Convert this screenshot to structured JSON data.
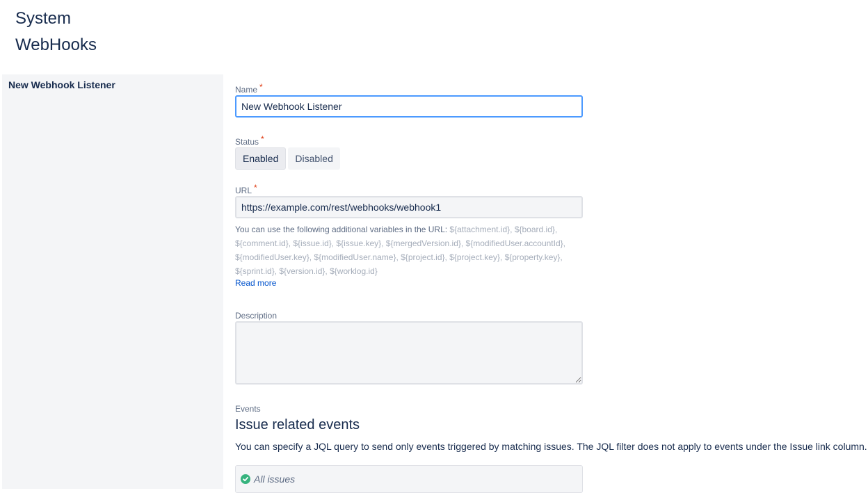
{
  "header": {
    "title_line1": "System",
    "title_line2": "WebHooks"
  },
  "sidebar": {
    "items": [
      {
        "label": "New Webhook Listener"
      }
    ]
  },
  "form": {
    "name": {
      "label": "Name",
      "required_mark": "*",
      "value": "New Webhook Listener"
    },
    "status": {
      "label": "Status",
      "required_mark": "*",
      "options": [
        "Enabled",
        "Disabled"
      ],
      "selected": "Enabled"
    },
    "url": {
      "label": "URL",
      "required_mark": "*",
      "value": "https://example.com/rest/webhooks/webhook1",
      "help_prefix": "You can use the following additional variables in the URL: ",
      "variables_line1": "${attachment.id}, ${board.id},",
      "variables_line2": "${comment.id}, ${issue.id}, ${issue.key}, ${mergedVersion.id}, ${modifiedUser.accountId},",
      "variables_line3": "${modifiedUser.key}, ${modifiedUser.name}, ${project.id}, ${project.key}, ${property.key},",
      "variables_line4": "${sprint.id}, ${version.id}, ${worklog.id}",
      "read_more": "Read more"
    },
    "description": {
      "label": "Description",
      "value": ""
    },
    "events": {
      "label": "Events",
      "heading": "Issue related events",
      "description": "You can specify a JQL query to send only events triggered by matching issues. The JQL filter does not apply to events under the Issue link column.",
      "jql_value": "All issues",
      "jql_icon": "check-circle-icon"
    }
  },
  "colors": {
    "accent": "#4c9aff",
    "link": "#0052cc",
    "required": "#de350b",
    "success": "#36b37e"
  }
}
